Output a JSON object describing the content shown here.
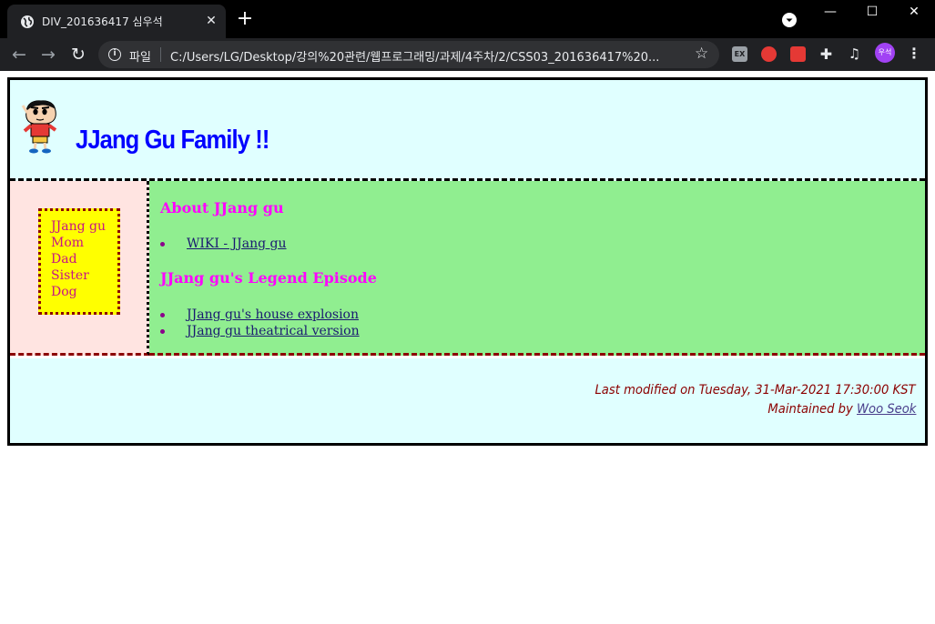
{
  "browser": {
    "tab_title": "DIV_201636417 심우석",
    "tab_close": "✕",
    "new_tab": "+",
    "window_minimize": "—",
    "window_maximize": "☐",
    "window_close": "✕",
    "url_scheme": "파일",
    "url": "C:/Users/LG/Desktop/강의%20관련/웹프로그래밍/과제/4주차/2/CSS03_201636417%20...",
    "profile_initials": "우석",
    "extension_label": "EX",
    "icons": [
      "globe-icon",
      "back-icon",
      "forward-icon",
      "reload-icon",
      "info-icon",
      "star-icon",
      "puzzle-icon",
      "media-icon",
      "kebab-menu-icon"
    ]
  },
  "header": {
    "title": "JJang Gu Family !!",
    "title_color": "#0000ff",
    "background": "#e0ffff"
  },
  "sidebar": {
    "items": [
      "JJang gu",
      "Mom",
      "Dad",
      "Sister",
      "Dog"
    ],
    "background": "#ffe4e1",
    "box_color": "#ffff00",
    "text_color": "#c71585"
  },
  "main": {
    "sections": [
      {
        "heading": "About JJang gu",
        "links": [
          "WIKI - JJang gu"
        ]
      },
      {
        "heading": "JJang gu's Legend Episode",
        "links": [
          "JJang gu's house explosion",
          "JJang gu theatrical version"
        ]
      }
    ],
    "background": "#90ee90",
    "heading_color": "#ff00ff"
  },
  "footer": {
    "last_modified": "Last modified on Tuesday, 31-Mar-2021 17:30:00 KST",
    "maintained_prefix": "Maintained by ",
    "maintainer": "Woo Seok",
    "text_color": "#8b0000"
  }
}
